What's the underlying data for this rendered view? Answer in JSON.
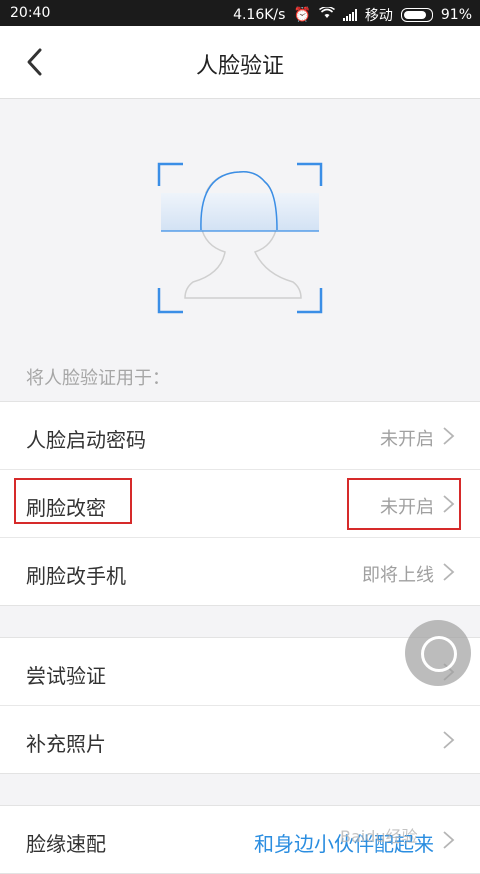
{
  "status_bar": {
    "time": "20:40",
    "speed": "4.16K/s",
    "carrier": "移动",
    "battery": "91%",
    "battery_level": 0.91,
    "icons": [
      "alarm-icon",
      "wifi-icon",
      "signal-icon",
      "battery-icon"
    ]
  },
  "nav": {
    "title": "人脸验证",
    "back_icon": "chevron-left-icon"
  },
  "section_label": "将人脸验证用于：",
  "group1": [
    {
      "label": "人脸启动密码",
      "value": "未开启"
    },
    {
      "label": "刷脸改密",
      "value": "未开启"
    },
    {
      "label": "刷脸改手机",
      "value": "即将上线"
    }
  ],
  "group2": [
    {
      "label": "尝试验证",
      "value": ""
    },
    {
      "label": "补充照片",
      "value": ""
    }
  ],
  "group3": [
    {
      "label": "脸缘速配",
      "value": "和身边小伙伴配起来"
    }
  ],
  "colors": {
    "accent_blue": "#2a8de0",
    "highlight_red": "#d62a2a",
    "scan_frame": "#3a8ee6"
  },
  "watermark": "Baidu经验"
}
